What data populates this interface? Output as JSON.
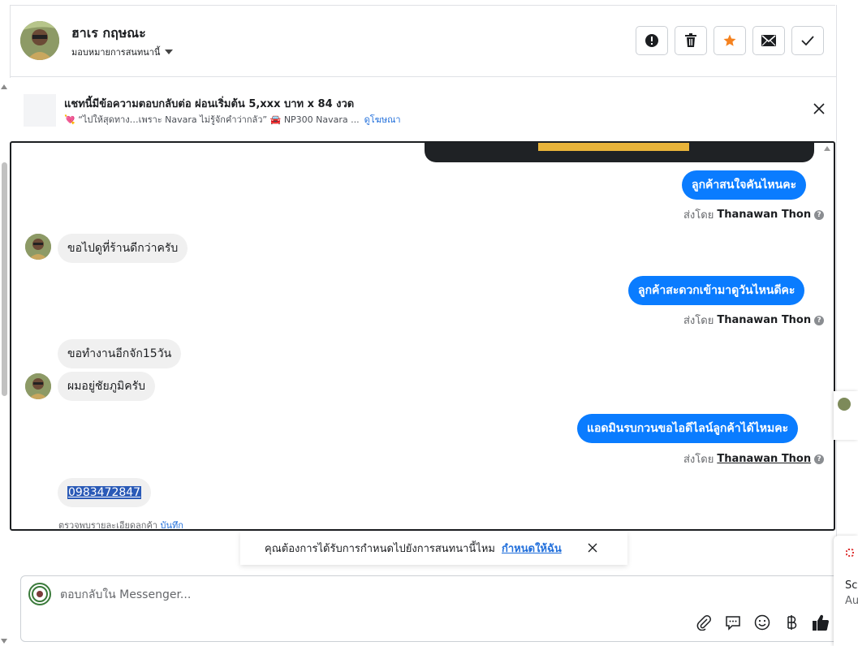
{
  "header": {
    "contact_name": "ฮาเร กฤษณะ",
    "assign_label": "มอบหมายการสนทนานี้"
  },
  "ad": {
    "title": "แชทนี้มีข้อความตอบกลับต่อ ผ่อนเริ่มต้น 5,xxx บาท x 84 งวด",
    "subtitle": "💘 “ไปให้สุดทาง…เพราะ Navara ไม่รู้จักคำว่ากลัว” 🚘 NP300 Navara ...",
    "link": "ดูโฆษณา"
  },
  "messages": {
    "out1": "ลูกค้าสนใจคันไหนคะ",
    "in1": "ขอไปดูที่ร้านดีกว่าครับ",
    "out2": "ลูกค้าสะดวกเข้ามาดูวันไหนดีคะ",
    "in2": "ขอทำงานอีกจัก15วัน",
    "in3": "ผมอยู่ชัยภูมิครับ",
    "out3": "แอดมินรบกวนขอไอดีไลน์ลูกค้าได้ไหมคะ",
    "in4_phone": "0983472847",
    "sent_by_prefix": "ส่งโดย",
    "sender_name": "Thanawan Thon"
  },
  "detail": {
    "text": "ตรวจพบรายละเอียดลูกค้า",
    "link": "บันทึก"
  },
  "toast": {
    "text": "คุณต้องการได้รับการกำหนดไปยังการสนทนานี้ไหม",
    "link": "กำหนดให้ฉัน"
  },
  "composer": {
    "placeholder": "ตอบกลับใน Messenger..."
  },
  "peek": {
    "line1": "Sc",
    "line2": "Au"
  },
  "colors": {
    "accent": "#0a7cff",
    "link": "#216fdb",
    "star": "#f5821f"
  },
  "icons": {
    "actions": [
      "alert-icon",
      "trash-icon",
      "star-icon",
      "mail-icon",
      "check-icon"
    ],
    "tools": [
      "paperclip-icon",
      "speech-bubble-icon",
      "emoji-icon",
      "baht-icon",
      "thumbs-up-icon"
    ]
  }
}
